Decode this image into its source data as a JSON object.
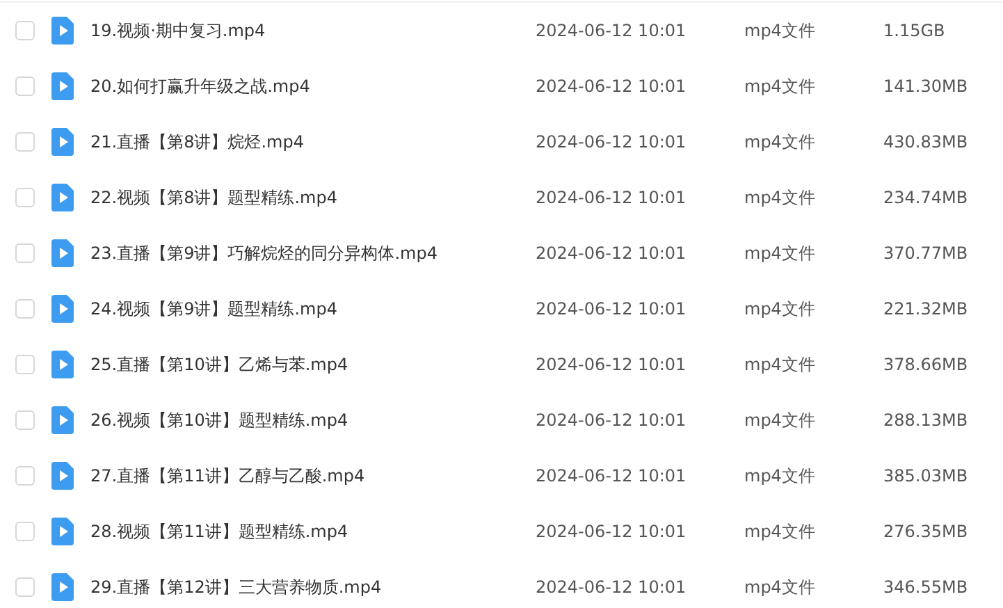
{
  "files": [
    {
      "name": "19.视频·期中复习.mp4",
      "modified": "2024-06-12 10:01",
      "type": "mp4文件",
      "size": "1.15GB",
      "checked": false
    },
    {
      "name": "20.如何打赢升年级之战.mp4",
      "modified": "2024-06-12 10:01",
      "type": "mp4文件",
      "size": "141.30MB",
      "checked": false
    },
    {
      "name": "21.直播【第8讲】烷烃.mp4",
      "modified": "2024-06-12 10:01",
      "type": "mp4文件",
      "size": "430.83MB",
      "checked": false
    },
    {
      "name": "22.视频【第8讲】题型精练.mp4",
      "modified": "2024-06-12 10:01",
      "type": "mp4文件",
      "size": "234.74MB",
      "checked": false
    },
    {
      "name": "23.直播【第9讲】巧解烷烃的同分异构体.mp4",
      "modified": "2024-06-12 10:01",
      "type": "mp4文件",
      "size": "370.77MB",
      "checked": false
    },
    {
      "name": "24.视频【第9讲】题型精练.mp4",
      "modified": "2024-06-12 10:01",
      "type": "mp4文件",
      "size": "221.32MB",
      "checked": false
    },
    {
      "name": "25.直播【第10讲】乙烯与苯.mp4",
      "modified": "2024-06-12 10:01",
      "type": "mp4文件",
      "size": "378.66MB",
      "checked": false
    },
    {
      "name": "26.视频【第10讲】题型精练.mp4",
      "modified": "2024-06-12 10:01",
      "type": "mp4文件",
      "size": "288.13MB",
      "checked": false
    },
    {
      "name": "27.直播【第11讲】乙醇与乙酸.mp4",
      "modified": "2024-06-12 10:01",
      "type": "mp4文件",
      "size": "385.03MB",
      "checked": false
    },
    {
      "name": "28.视频【第11讲】题型精练.mp4",
      "modified": "2024-06-12 10:01",
      "type": "mp4文件",
      "size": "276.35MB",
      "checked": false
    },
    {
      "name": "29.直播【第12讲】三大营养物质.mp4",
      "modified": "2024-06-12 10:01",
      "type": "mp4文件",
      "size": "346.55MB",
      "checked": false
    }
  ]
}
